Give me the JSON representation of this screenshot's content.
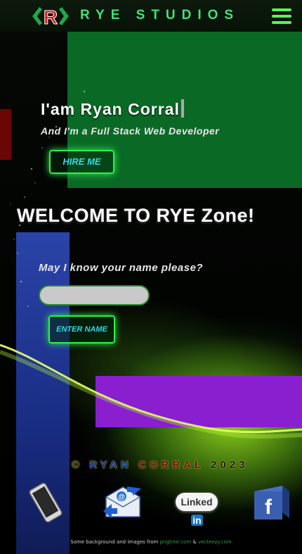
{
  "header": {
    "logo_letter": "R",
    "brand": "RYE STUDIOS",
    "menu_icon": "hamburger-menu-icon"
  },
  "hero": {
    "title": "I'am Ryan Corral",
    "subtitle": "And I'm a Full Stack Web Developer",
    "hire_button": "HIRE ME"
  },
  "welcome": {
    "heading": "WELCOME TO RYE Zone!",
    "question": "May I know your name please?",
    "name_input_value": "",
    "name_input_placeholder": "",
    "enter_button": "ENTER NAME"
  },
  "footer": {
    "copyright_symbol": "©",
    "copyright_first": "RYAN",
    "copyright_last": "CORRAL",
    "copyright_year": "2023",
    "social": [
      {
        "name": "phone",
        "icon": "smartphone-icon"
      },
      {
        "name": "email",
        "icon": "email-envelope-icon"
      },
      {
        "name": "linkedin",
        "label_text": "Linked",
        "label_in": "in",
        "icon": "linkedin-icon"
      },
      {
        "name": "facebook",
        "icon": "facebook-icon"
      }
    ],
    "credit_prefix": "Some background and images from",
    "credit_link1": "pngtree.com",
    "credit_and": "&",
    "credit_link2": "vecteezy.com"
  },
  "colors": {
    "accent_green": "#3fe27a",
    "button_text_cyan": "#37d6e8",
    "hero_block_green": "#0a6a25",
    "purple_block": "#8a1fd0",
    "blue_strip": "#2c47b0"
  }
}
